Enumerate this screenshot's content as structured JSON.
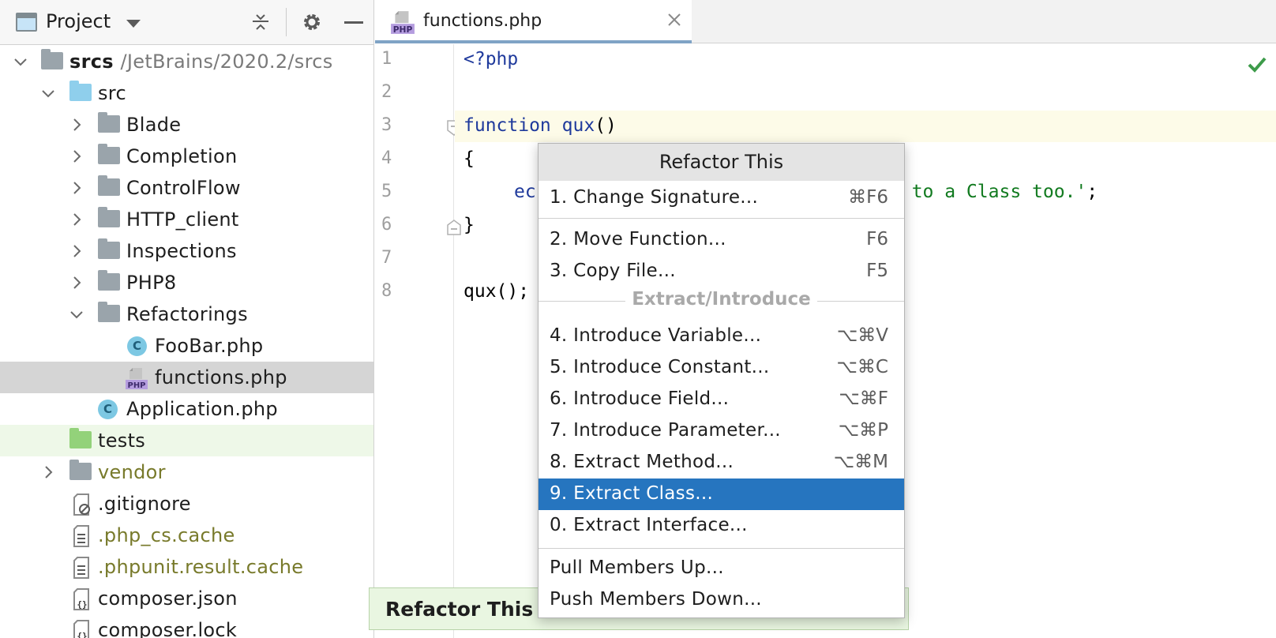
{
  "project_panel": {
    "title": "Project",
    "tree": [
      {
        "label": "srcs",
        "path": "/JetBrains/2020.2/srcs",
        "type": "folder",
        "depth": 0,
        "expanded": true
      },
      {
        "label": "src",
        "type": "src-folder",
        "depth": 1,
        "expanded": true
      },
      {
        "label": "Blade",
        "type": "folder",
        "depth": 2,
        "expanded": false
      },
      {
        "label": "Completion",
        "type": "folder",
        "depth": 2,
        "expanded": false
      },
      {
        "label": "ControlFlow",
        "type": "folder",
        "depth": 2,
        "expanded": false
      },
      {
        "label": "HTTP_client",
        "type": "folder",
        "depth": 2,
        "expanded": false
      },
      {
        "label": "Inspections",
        "type": "folder",
        "depth": 2,
        "expanded": false
      },
      {
        "label": "PHP8",
        "type": "folder",
        "depth": 2,
        "expanded": false
      },
      {
        "label": "Refactorings",
        "type": "folder",
        "depth": 2,
        "expanded": true
      },
      {
        "label": "FooBar.php",
        "type": "class",
        "depth": 3
      },
      {
        "label": "functions.php",
        "type": "php",
        "depth": 3,
        "selected": true
      },
      {
        "label": "Application.php",
        "type": "class",
        "depth": 2
      },
      {
        "label": "tests",
        "type": "tests-folder",
        "depth": 1
      },
      {
        "label": "vendor",
        "type": "folder",
        "depth": 1,
        "expanded": false,
        "excluded": true
      },
      {
        "label": ".gitignore",
        "type": "ignore-file",
        "depth": 1
      },
      {
        "label": ".php_cs.cache",
        "type": "text-file",
        "depth": 1,
        "excluded": true
      },
      {
        "label": ".phpunit.result.cache",
        "type": "text-file",
        "depth": 1,
        "excluded": true
      },
      {
        "label": "composer.json",
        "type": "json-file",
        "depth": 1
      },
      {
        "label": "composer.lock",
        "type": "json-file",
        "depth": 1
      }
    ]
  },
  "editor": {
    "tab_label": "functions.php",
    "line_numbers": [
      "1",
      "2",
      "3",
      "4",
      "5",
      "6",
      "7",
      "8"
    ],
    "code": {
      "l1": "<?php",
      "l3_kw": "function",
      "l3_fn": "qux",
      "l3_rest": "()",
      "l4": "{",
      "l5_kw": "ec",
      "l5_str": "d to a Class too.'",
      "l5_end": ";",
      "l6": "}",
      "l8": "qux();"
    }
  },
  "popup": {
    "title": "Refactor This",
    "items_top": [
      {
        "label": "1. Change Signature...",
        "shortcut": "⌘F6"
      }
    ],
    "items_mid": [
      {
        "label": "2. Move Function...",
        "shortcut": "F6"
      },
      {
        "label": "3. Copy File...",
        "shortcut": "F5"
      }
    ],
    "group_label": "Extract/Introduce",
    "items_extract": [
      {
        "label": "4. Introduce Variable...",
        "shortcut": "⌥⌘V"
      },
      {
        "label": "5. Introduce Constant...",
        "shortcut": "⌥⌘C"
      },
      {
        "label": "6. Introduce Field...",
        "shortcut": "⌥⌘F"
      },
      {
        "label": "7. Introduce Parameter...",
        "shortcut": "⌥⌘P"
      },
      {
        "label": "8. Extract Method...",
        "shortcut": "⌥⌘M"
      },
      {
        "label": "9. Extract Class...",
        "shortcut": "",
        "active": true
      },
      {
        "label": "0. Extract Interface...",
        "shortcut": ""
      }
    ],
    "items_bottom": [
      {
        "label": "Pull Members Up...",
        "shortcut": ""
      },
      {
        "label": "Push Members Down...",
        "shortcut": ""
      }
    ]
  },
  "hint_banner": {
    "text": "Refactor This"
  },
  "colors": {
    "selection": "#2675bf",
    "keyword": "#1f3a9c",
    "string": "#117a1f",
    "excluded": "#787a2b"
  }
}
